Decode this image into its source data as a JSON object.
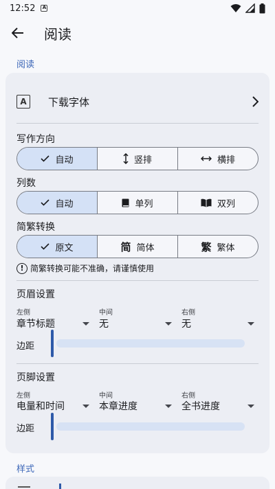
{
  "status": {
    "time": "12:52",
    "notif_icon": "A"
  },
  "appbar": {
    "title": "阅读"
  },
  "sections": {
    "reading": "阅读",
    "style": "样式"
  },
  "download": {
    "label": "下载字体"
  },
  "direction": {
    "title": "写作方向",
    "options": [
      {
        "label": "自动",
        "icon": "check-icon",
        "selected": true
      },
      {
        "label": "竖排",
        "icon": "vertical-arrows-icon",
        "selected": false
      },
      {
        "label": "横排",
        "icon": "horizontal-arrows-icon",
        "selected": false
      }
    ]
  },
  "columns": {
    "title": "列数",
    "options": [
      {
        "label": "自动",
        "icon": "check-icon",
        "selected": true
      },
      {
        "label": "单列",
        "icon": "single-book-icon",
        "selected": false
      },
      {
        "label": "双列",
        "icon": "open-book-icon",
        "selected": false
      }
    ]
  },
  "conversion": {
    "title": "简繁转换",
    "options": [
      {
        "label": "原文",
        "icon": "check-icon",
        "selected": true
      },
      {
        "label": "简体",
        "glyph": "简",
        "selected": false
      },
      {
        "label": "繁体",
        "glyph": "繁",
        "selected": false
      }
    ],
    "warning": "简繁转换可能不准确，请谨慎使用"
  },
  "header": {
    "title": "页眉设置",
    "left_label": "左侧",
    "left_value": "章节标题",
    "center_label": "中间",
    "center_value": "无",
    "right_label": "右侧",
    "right_value": "无",
    "margin_label": "边距",
    "margin_value": 0
  },
  "footer": {
    "title": "页脚设置",
    "left_label": "左侧",
    "left_value": "电量和时间",
    "center_label": "中间",
    "center_value": "本章进度",
    "right_label": "右侧",
    "right_value": "全书进度",
    "margin_label": "边距",
    "margin_value": 0
  },
  "colors": {
    "accent": "#3d67b8",
    "selected": "#d4e1f6",
    "card": "#eceef4"
  }
}
